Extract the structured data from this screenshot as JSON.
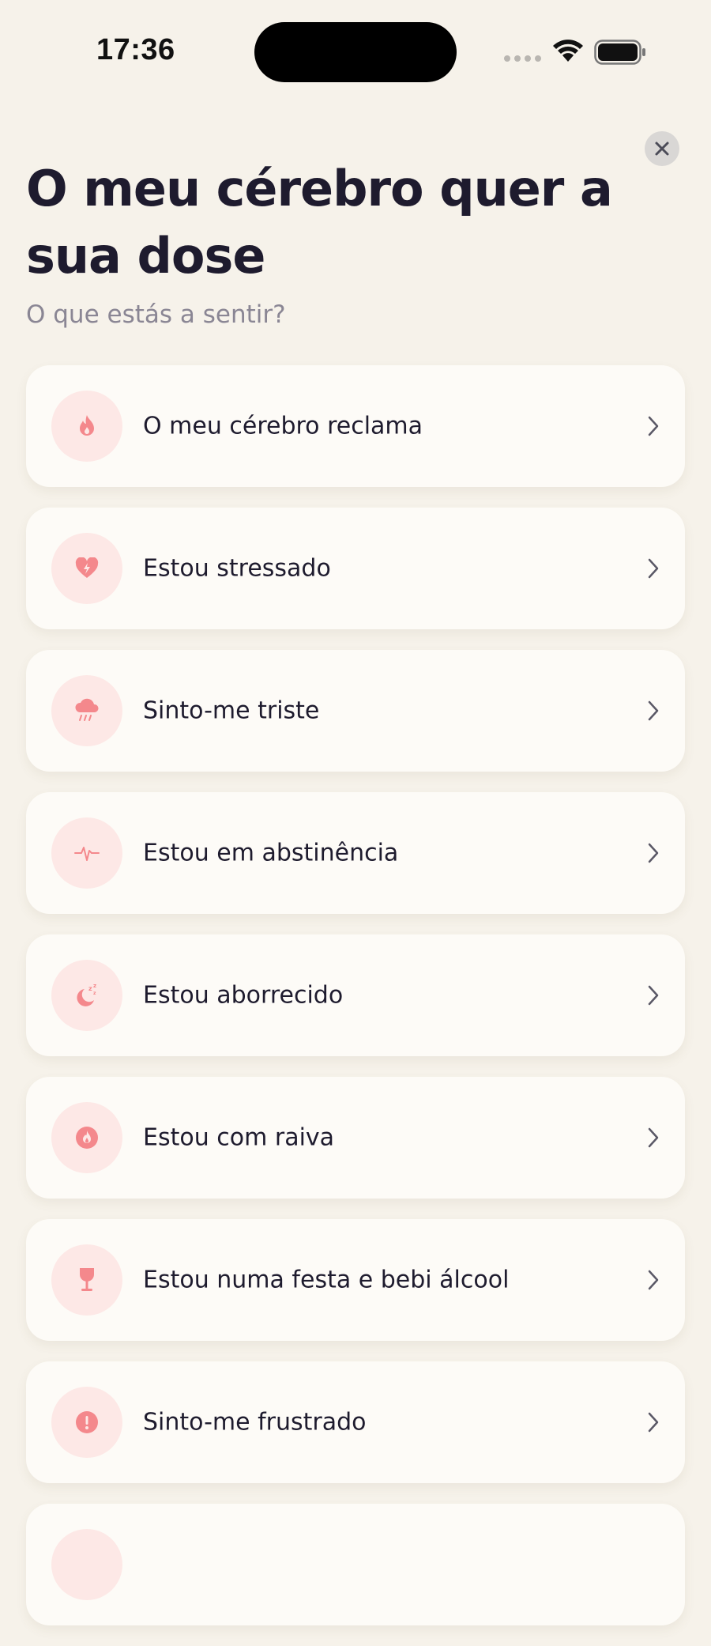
{
  "status_bar": {
    "time": "17:36"
  },
  "header": {
    "title": "O meu cérebro quer a sua dose",
    "subtitle": "O que estás a sentir?"
  },
  "colors": {
    "background": "#f6f2ea",
    "card": "#fdfbf7",
    "icon_bg": "#fde8e6",
    "icon_accent": "#f4888c",
    "title": "#1e1b2e",
    "subtitle": "#8a8694"
  },
  "items": [
    {
      "label": "O meu cérebro reclama",
      "icon": "flame-icon"
    },
    {
      "label": "Estou stressado",
      "icon": "heart-bolt-icon"
    },
    {
      "label": "Sinto-me triste",
      "icon": "rain-cloud-icon"
    },
    {
      "label": "Estou em abstinência",
      "icon": "pulse-icon"
    },
    {
      "label": "Estou aborrecido",
      "icon": "moon-sleep-icon"
    },
    {
      "label": "Estou com raiva",
      "icon": "angry-flame-icon"
    },
    {
      "label": "Estou numa festa e bebi álcool",
      "icon": "wine-glass-icon"
    },
    {
      "label": "Sinto-me frustrado",
      "icon": "alert-icon"
    },
    {
      "label": "",
      "icon": "partial-icon"
    }
  ]
}
